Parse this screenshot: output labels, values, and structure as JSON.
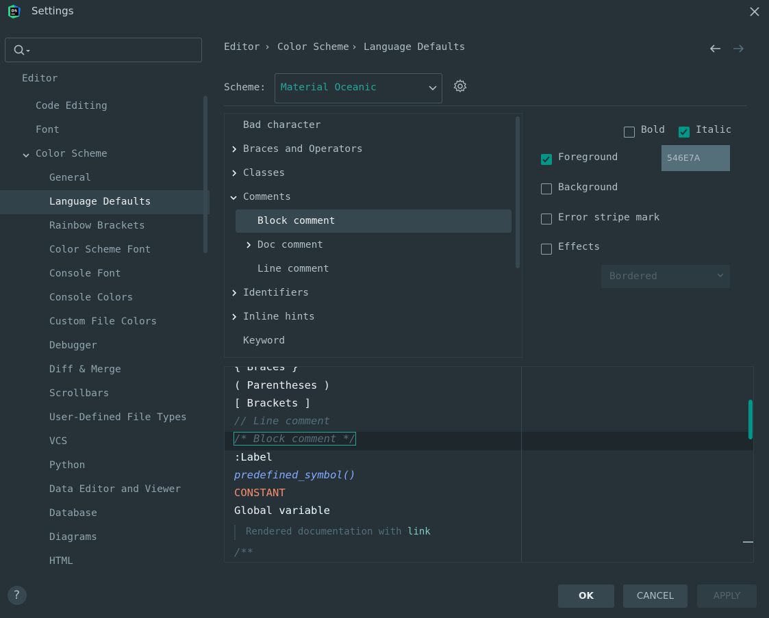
{
  "window": {
    "title": "Settings",
    "app_icon_text": "DS"
  },
  "sidebar": {
    "search_placeholder": "",
    "items": [
      {
        "label": "Editor"
      },
      {
        "label": "Code Editing"
      },
      {
        "label": "Font"
      },
      {
        "label": "Color Scheme"
      },
      {
        "label": "General"
      },
      {
        "label": "Language Defaults"
      },
      {
        "label": "Rainbow Brackets"
      },
      {
        "label": "Color Scheme Font"
      },
      {
        "label": "Console Font"
      },
      {
        "label": "Console Colors"
      },
      {
        "label": "Custom File Colors"
      },
      {
        "label": "Debugger"
      },
      {
        "label": "Diff & Merge"
      },
      {
        "label": "Scrollbars"
      },
      {
        "label": "User-Defined File Types"
      },
      {
        "label": "VCS"
      },
      {
        "label": "Python"
      },
      {
        "label": "Data Editor and Viewer"
      },
      {
        "label": "Database"
      },
      {
        "label": "Diagrams"
      },
      {
        "label": "HTML"
      }
    ],
    "help_label": "?"
  },
  "breadcrumb": [
    "Editor",
    "Color Scheme",
    "Language Defaults"
  ],
  "scheme": {
    "label": "Scheme:",
    "value": "Material Oceanic"
  },
  "tree": {
    "items": [
      {
        "label": "Bad character"
      },
      {
        "label": "Braces and Operators"
      },
      {
        "label": "Classes"
      },
      {
        "label": "Comments"
      },
      {
        "label": "Block comment"
      },
      {
        "label": "Doc comment"
      },
      {
        "label": "Line comment"
      },
      {
        "label": "Identifiers"
      },
      {
        "label": "Inline hints"
      },
      {
        "label": "Keyword"
      }
    ]
  },
  "attributes": {
    "bold": {
      "label": "Bold",
      "checked": false
    },
    "italic": {
      "label": "Italic",
      "checked": true
    },
    "foreground": {
      "label": "Foreground",
      "checked": true,
      "value": "546E7A"
    },
    "background": {
      "label": "Background",
      "checked": false
    },
    "error_stripe": {
      "label": "Error stripe mark",
      "checked": false
    },
    "effects": {
      "label": "Effects",
      "checked": false,
      "type": "Bordered"
    }
  },
  "preview": {
    "braces": "{ Braces }",
    "parens": "( Parentheses )",
    "brackets": "[ Brackets ]",
    "line_comment": "// Line comment",
    "block_comment": "/* Block comment */",
    "label": ":Label",
    "predefined": "predefined_symbol()",
    "constant": "CONSTANT",
    "global_word": "Global",
    "global_var": "variable",
    "doc_text": "Rendered documentation with",
    "doc_link": "link",
    "doc_start": "/**"
  },
  "buttons": {
    "ok": "OK",
    "cancel": "CANCEL",
    "apply": "APPLY"
  },
  "colors": {
    "background": "#263238",
    "accent": "#009688",
    "teal_text": "#26A69A",
    "comment": "#546E7A",
    "constant": "#F78C6C",
    "function": "#82AAFF",
    "variable": "#EEFFFF"
  }
}
